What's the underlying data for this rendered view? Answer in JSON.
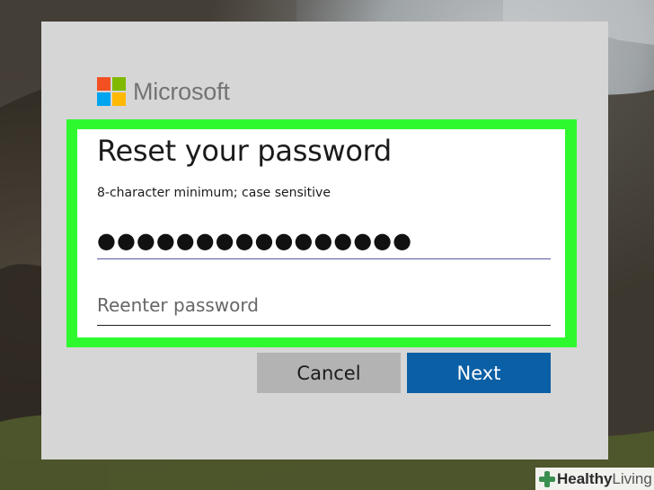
{
  "brand": {
    "name": "Microsoft",
    "logo_colors": [
      "#f25022",
      "#7fba00",
      "#00a4ef",
      "#ffb900"
    ]
  },
  "dialog": {
    "title": "Reset your password",
    "hint": "8-character minimum; case sensitive",
    "password_value": "●●●●●●●●●●●●●●●●",
    "reenter_placeholder": "Reenter password"
  },
  "buttons": {
    "cancel": "Cancel",
    "next": "Next"
  },
  "colors": {
    "highlight": "#2ef92e",
    "next_button": "#0b5fa5",
    "cancel_button": "#b3b3b3"
  },
  "watermark": {
    "part1": "Healthy",
    "part2": "Living",
    "icon": "cross-icon"
  }
}
